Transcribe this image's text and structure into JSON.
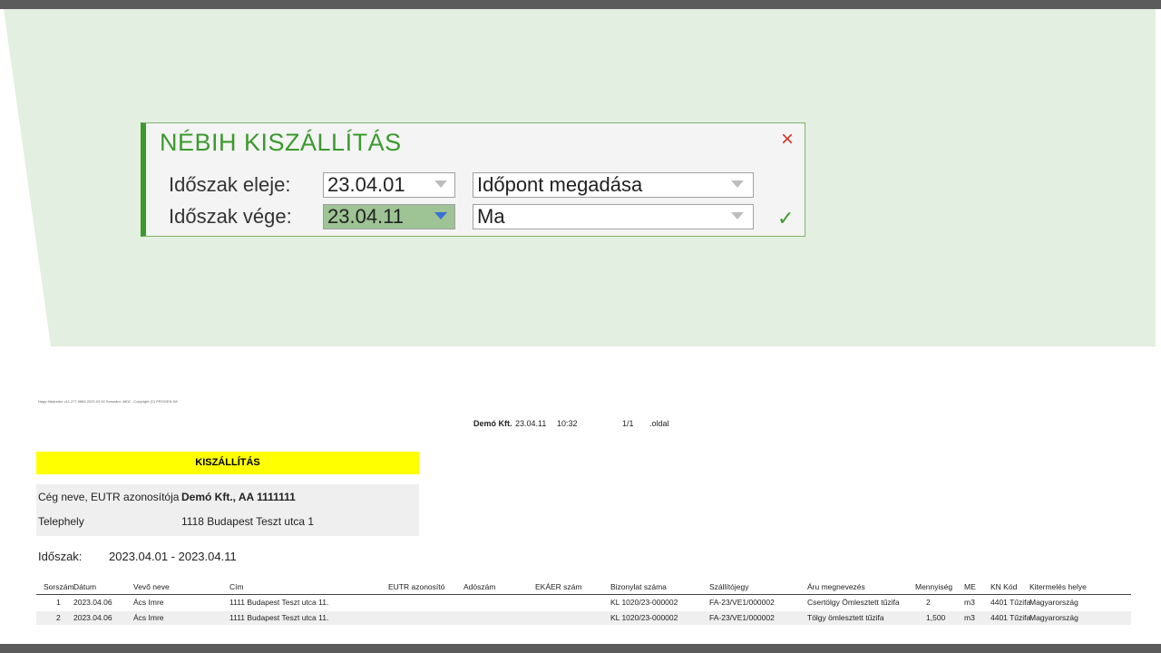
{
  "dialog": {
    "title": "NÉBIH KISZÁLLÍTÁS",
    "start_label": "Időszak eleje:",
    "start_value": "23.04.01",
    "start_mode": "Időpont megadása",
    "end_label": "Időszak vége:",
    "end_value": "23.04.11",
    "end_mode": "Ma",
    "close_icon": "×",
    "ok_icon": "✓"
  },
  "report": {
    "meta_small": "Nagy Madredor v11.277.9866 2023 03 30 Sorszám: 4802 - Copyright (C) PROGEN Kft.",
    "company_short": "Demó Kft.",
    "date": "23.04.11",
    "time": "10:32",
    "page": "1/1",
    "page_label": ".oldal",
    "title": "KISZÁLLÍTÁS",
    "company_label": "Cég neve, EUTR azonosítója",
    "company_value": "Demó Kft., AA 1111111",
    "site_label": "Telephely",
    "site_value": "1118 Budapest Teszt utca 1",
    "period_label": "Időszak:",
    "period_value": "2023.04.01 - 2023.04.11",
    "columns": [
      "Sorszám",
      "Dátum",
      "Vevő neve",
      "Cím",
      "EUTR azonosító",
      "Adószám",
      "EKÁER szám",
      "Bizonylat száma",
      "Szállítójegy",
      "Áru megnevezés",
      "Mennyiség",
      "ME",
      "KN Kód",
      "Kitermelés helye"
    ],
    "rows": [
      [
        "1",
        "2023.04.06",
        "Ács Imre",
        "1111 Budapest Teszt utca 11.",
        "",
        "",
        "",
        "KL 1020/23-000002",
        "FA-23/VE1/000002",
        "Csertölgy Ömlesztett tűzifa",
        "2",
        "m3",
        "4401 Tűzifa",
        "Magyarország"
      ],
      [
        "2",
        "2023.04.06",
        "Ács Imre",
        "1111 Budapest Teszt utca 11.",
        "",
        "",
        "",
        "KL 1020/23-000002",
        "FA-23/VE1/000002",
        "Tölgy ömlesztett tűzifa",
        "1,500",
        "m3",
        "4401 Tűzifa",
        "Magyarország"
      ]
    ]
  },
  "colors": {
    "accent": "#3b9a2e",
    "panel": "#e3efe0",
    "close": "#d23a2a",
    "highlight": "#ffff00"
  }
}
